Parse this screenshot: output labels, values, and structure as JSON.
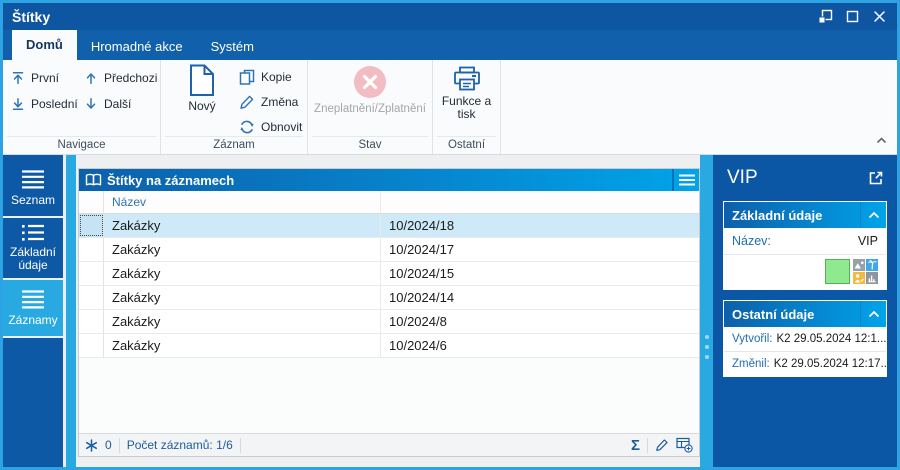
{
  "theme": {
    "titlebar_bg": "#0F56A2",
    "tabbar_bg": "#1160AC",
    "accent_blue": "#29A9E1",
    "dark_panel_blue": "#0B57A5",
    "header_gradient_start": "#0D5FAB",
    "header_gradient_end": "#00A4E9",
    "selected_row_bg": "#CEE9F7",
    "link_blue": "#1F6DB5",
    "swatch_green": "#8FE98F"
  },
  "window": {
    "title": "Štítky"
  },
  "tabs": [
    {
      "label": "Domů",
      "active": true
    },
    {
      "label": "Hromadné akce",
      "active": false
    },
    {
      "label": "Systém",
      "active": false
    }
  ],
  "ribbon": {
    "groups": [
      {
        "label": "Navigace"
      },
      {
        "label": "Záznam"
      },
      {
        "label": "Stav"
      },
      {
        "label": "Ostatní"
      }
    ],
    "buttons": {
      "first": "První",
      "last": "Poslední",
      "previous": "Předchozi",
      "next": "Další",
      "new": "Nový",
      "copy": "Kopie",
      "change": "Změna",
      "refresh": "Obnovit",
      "invalidate": "Zneplatnění/Zplatnění",
      "functions_print": "Funkce a tisk"
    }
  },
  "sidebar": {
    "items": [
      {
        "label": "Seznam",
        "active": false
      },
      {
        "label": "Základní údaje",
        "active": false
      },
      {
        "label": "Záznamy",
        "active": true
      }
    ]
  },
  "table": {
    "title": "Štítky na záznamech",
    "columns": {
      "name": "Název"
    },
    "selected_index": 0,
    "rows": [
      {
        "name": "Zakázky",
        "ref": "10/2024/18"
      },
      {
        "name": "Zakázky",
        "ref": "10/2024/17"
      },
      {
        "name": "Zakázky",
        "ref": "10/2024/15"
      },
      {
        "name": "Zakázky",
        "ref": "10/2024/14"
      },
      {
        "name": "Zakázky",
        "ref": "10/2024/8"
      },
      {
        "name": "Zakázky",
        "ref": "10/2024/6"
      }
    ],
    "status": {
      "marked_count": "0",
      "records": "Počet záznamů: 1/6",
      "sigma": "Σ"
    }
  },
  "detail": {
    "title": "VIP",
    "basic_section": {
      "title": "Základní údaje",
      "name_label": "Název:",
      "name_value": "VIP"
    },
    "other_section": {
      "title": "Ostatní údaje",
      "created_label": "Vytvořil:",
      "created_value": "K2 29.05.2024 12:1...",
      "changed_label": "Změnil:",
      "changed_value": "K2 29.05.2024 12:17..."
    }
  }
}
